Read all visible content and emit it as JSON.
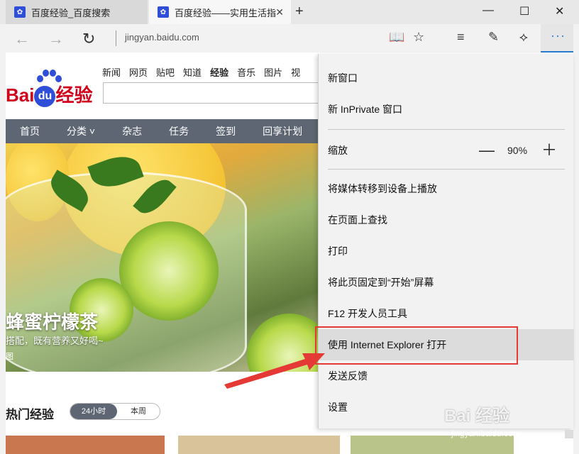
{
  "tabs": [
    {
      "title": "百度经验_百度搜索",
      "active": false
    },
    {
      "title": "百度经验——实用生活指",
      "active": true
    }
  ],
  "address_bar": {
    "url": "jingyan.baidu.com"
  },
  "window_controls": {
    "minimize": "—",
    "maximize": "☐",
    "close": "✕"
  },
  "page": {
    "logo_text": "Bai",
    "logo_du": "du",
    "logo_suffix": "经验",
    "top_links": [
      "新闻",
      "网页",
      "贴吧",
      "知道",
      "经验",
      "音乐",
      "图片",
      "视"
    ],
    "active_link": "经验",
    "category_nav": [
      "首页",
      "分类 ˅",
      "杂志",
      "任务",
      "签到",
      "回享计划"
    ],
    "hero": {
      "title": "蜂蜜柠檬茶",
      "subtitle": "搭配，既有营养又好喝~",
      "more": "图"
    },
    "hot_title": "热门经验",
    "hot_tabs": {
      "active": "24小时",
      "inactive": "本周"
    }
  },
  "menu": {
    "items": [
      {
        "label": "新窗口"
      },
      {
        "label": "新 InPrivate 窗口"
      },
      {
        "label": "缩放",
        "zoom": "90%"
      },
      {
        "label": "将媒体转移到设备上播放"
      },
      {
        "label": "在页面上查找"
      },
      {
        "label": "打印"
      },
      {
        "label": "将此页固定到“开始”屏幕"
      },
      {
        "label": "F12 开发人员工具"
      },
      {
        "label": "使用 Internet Explorer 打开",
        "highlighted": true
      },
      {
        "label": "发送反馈"
      },
      {
        "label": "设置"
      }
    ]
  },
  "watermark": {
    "brand": "Bai 经验",
    "url": "jingyan.baidu.com"
  },
  "colors": {
    "accent": "#2b7bd0",
    "highlight_box": "#e53935",
    "nav_bg": "#5d6672",
    "logo_red": "#d0021b",
    "logo_blue": "#2f4fd8"
  }
}
